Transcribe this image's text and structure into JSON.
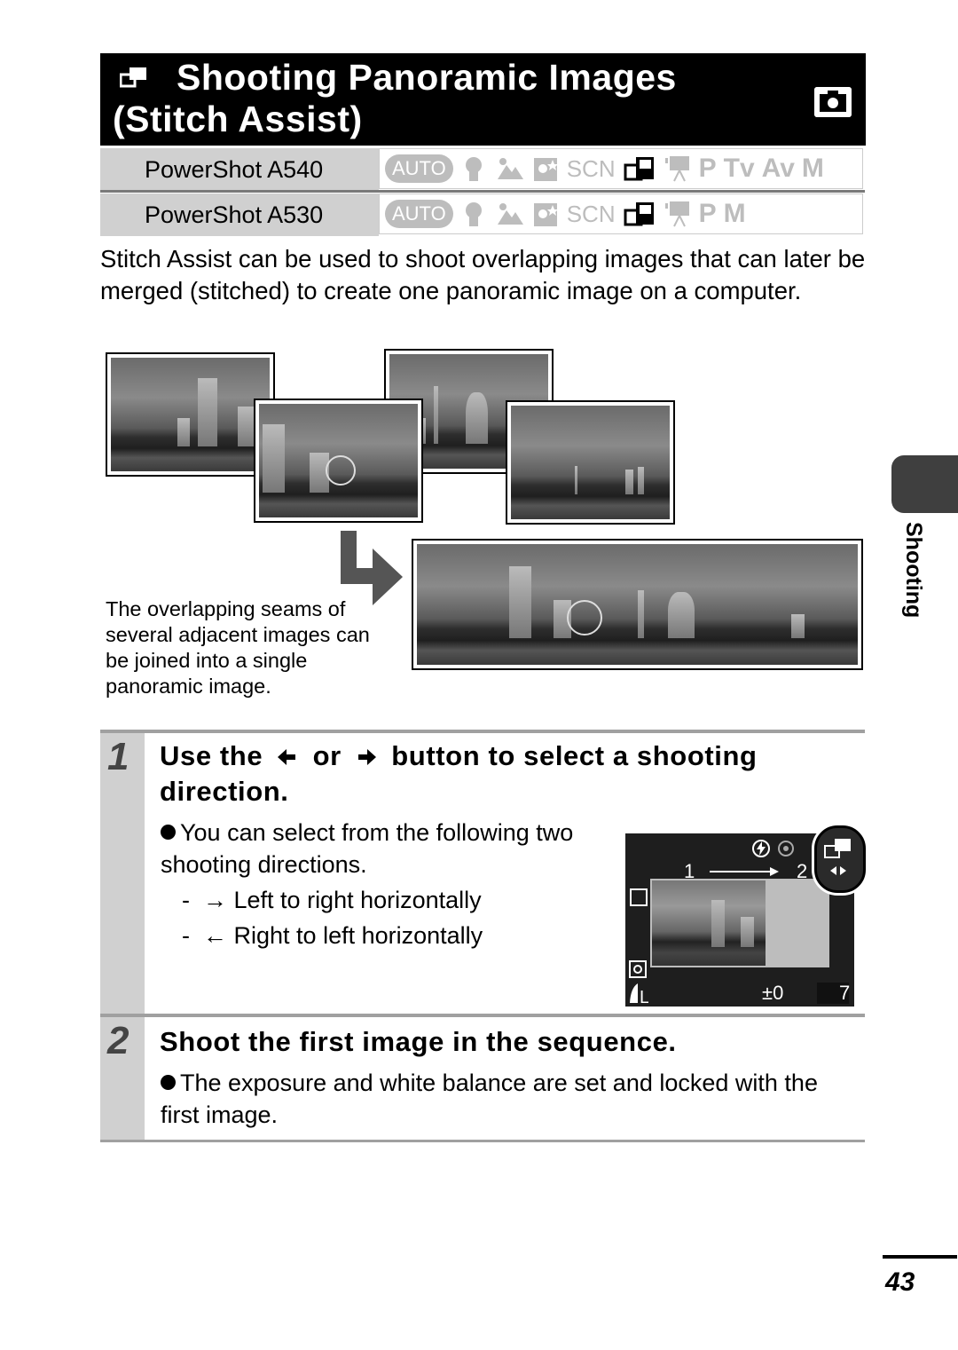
{
  "header": {
    "title_line1": "Shooting Panoramic Images",
    "title_line2": "(Stitch Assist)",
    "title_icon": "stitch-assist-icon",
    "mode_badge_icon": "camera-icon"
  },
  "models": [
    {
      "name": "PowerShot A540",
      "modes": [
        "AUTO",
        "portrait",
        "landscape",
        "night-snapshot",
        "SCN",
        "stitch-assist",
        "movie",
        "P",
        "Tv",
        "Av",
        "M"
      ],
      "active_mode": "stitch-assist"
    },
    {
      "name": "PowerShot A530",
      "modes": [
        "AUTO",
        "portrait",
        "landscape",
        "night-snapshot",
        "SCN",
        "stitch-assist",
        "movie",
        "P",
        "M"
      ],
      "active_mode": "stitch-assist"
    }
  ],
  "mode_labels": {
    "auto": "AUTO",
    "scn": "SCN",
    "p": "P",
    "tv": "Tv",
    "av": "Av",
    "m": "M"
  },
  "intro": "Stitch Assist can be used to shoot overlapping images that can later be merged (stitched) to create one panoramic image on a computer.",
  "illustration": {
    "caption": "The overlapping seams of several adjacent images can be joined into a single panoramic image.",
    "thumbnails": [
      "city-skyline-1",
      "city-skyline-2",
      "city-skyline-3",
      "city-skyline-4"
    ],
    "result": "panorama"
  },
  "steps": [
    {
      "number": "1",
      "heading_parts": [
        "Use the",
        "or",
        "button to select a shooting direction."
      ],
      "heading_icons": [
        "left-arrow-button-icon",
        "right-arrow-button-icon"
      ],
      "bullet": "You can select from the following two shooting directions.",
      "options": [
        {
          "arrow": "→",
          "label": "Left to right horizontally"
        },
        {
          "arrow": "←",
          "label": "Right to left horizontally"
        }
      ],
      "lcd": {
        "frame_start": "1",
        "frame_next": "2",
        "exposure": "±0",
        "shots_remaining": "7",
        "quality": "L"
      }
    },
    {
      "number": "2",
      "heading": "Shoot the first image in the sequence.",
      "bullet": "The exposure and white balance are set and locked with the first image."
    }
  ],
  "side_tab": {
    "label": "Shooting"
  },
  "page_number": "43"
}
